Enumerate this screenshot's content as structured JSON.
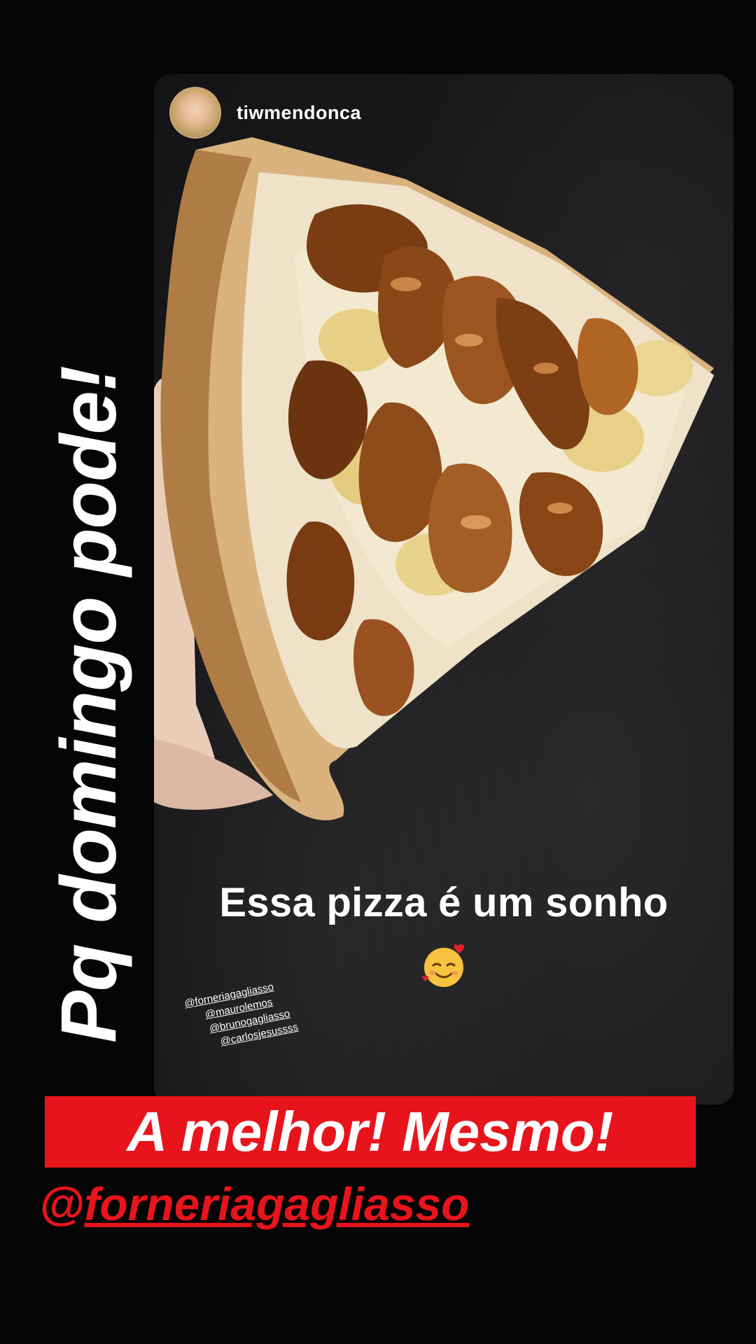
{
  "story": {
    "username": "tiwmendonca",
    "caption": "Essa pizza é um sonho",
    "emoji": "smiling-face-with-hearts-icon",
    "mentions": [
      "@forneriagagliasso",
      "@maurolemos",
      "@brunogagliasso",
      "@carlosjesussss"
    ]
  },
  "overlay": {
    "vertical_text": "Pq domingo pode!",
    "banner_text": "A melhor! Mesmo!",
    "handle_at": "@",
    "handle_text": "forneriagagliasso"
  },
  "colors": {
    "banner": "#e8141c",
    "handle": "#e8141c",
    "background": "#050505"
  }
}
